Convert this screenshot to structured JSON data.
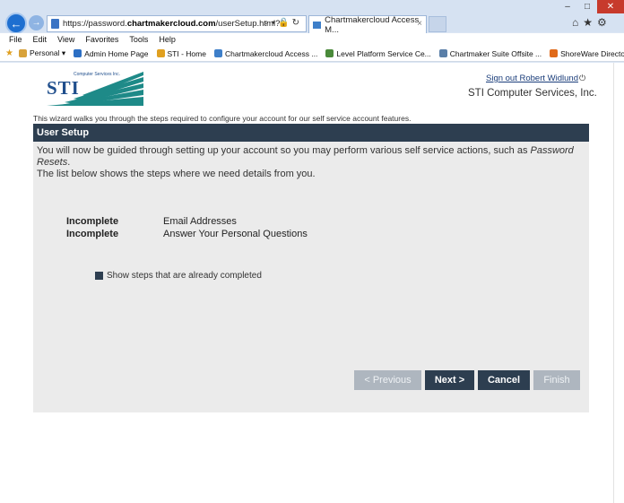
{
  "browser": {
    "url_prefix": "https://password.",
    "url_domain": "chartmakercloud.com",
    "url_path": "/userSetup.html?3",
    "tab_title": "Chartmakercloud Access M...",
    "tab_close": "×",
    "menu": [
      "File",
      "Edit",
      "View",
      "Favorites",
      "Tools",
      "Help"
    ],
    "favorites": [
      {
        "label": "Personal ▾",
        "color": "#d8a23a"
      },
      {
        "label": "Admin Home Page",
        "color": "#2c6fc4"
      },
      {
        "label": "STI - Home",
        "color": "#e0a020"
      },
      {
        "label": "Chartmakercloud Access ...",
        "color": "#3e7fc9"
      },
      {
        "label": "Level Platform Service Ce...",
        "color": "#4a8a3a"
      },
      {
        "label": "Chartmaker Suite Offsite ...",
        "color": "#5a7fa8"
      },
      {
        "label": "ShoreWare Director Login",
        "color": "#e06a1a"
      }
    ]
  },
  "header": {
    "logo_text": "STI",
    "logo_small": "Computer Services Inc.",
    "signout": "Sign out Robert Widlund",
    "company": "STI Computer Services, Inc."
  },
  "wizard": {
    "intro": "This wizard walks you through the steps required to configure your account for our self service account features.",
    "title": "User Setup",
    "desc_main": "You will now be guided through setting up your account so you may perform various self service actions, such as ",
    "desc_italic": "Password Resets",
    "desc_end": ".",
    "desc2": "The list below shows the steps where we need details from you.",
    "steps": [
      {
        "status": "Incomplete",
        "name": "Email Addresses"
      },
      {
        "status": "Incomplete",
        "name": "Answer Your Personal Questions"
      }
    ],
    "show_completed": "Show steps that are already completed",
    "buttons": {
      "previous": "< Previous",
      "next": "Next >",
      "cancel": "Cancel",
      "finish": "Finish"
    }
  },
  "colors": {
    "header_bg": "#2d3e50",
    "panel_bg": "#ebebeb",
    "disabled_btn": "#aeb6bf"
  }
}
